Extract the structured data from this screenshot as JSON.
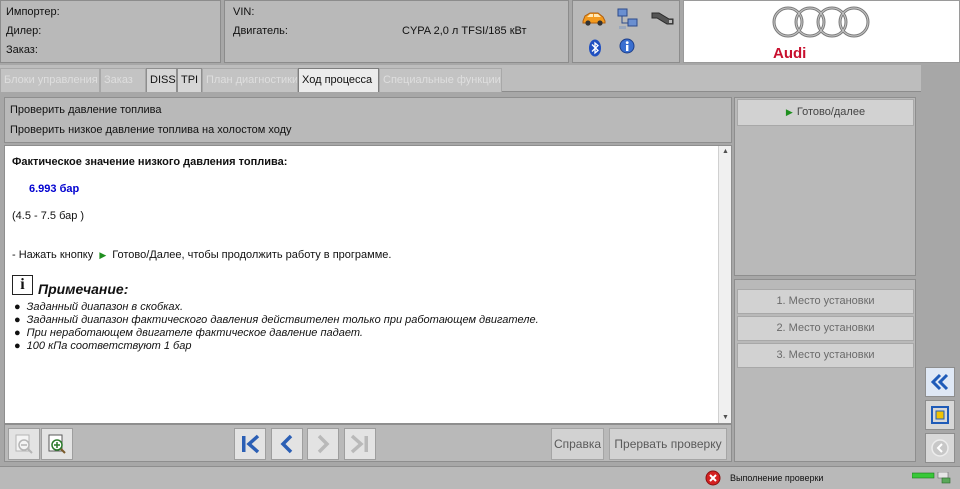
{
  "header": {
    "importer_label": "Импортер:",
    "dealer_label": "Дилер:",
    "order_label": "Заказ:",
    "vin_label": "VIN:",
    "engine_label": "Двигатель:",
    "engine_value": "CYPA 2,0 л TFSI/185 кВт",
    "brand": "Audi"
  },
  "tabs": [
    {
      "label": "Блоки управления"
    },
    {
      "label": "Заказ"
    },
    {
      "label": "DISS"
    },
    {
      "label": "TPI"
    },
    {
      "label": "План диагностики"
    },
    {
      "label": "Ход процесса"
    },
    {
      "label": "Специальные функции"
    }
  ],
  "panel": {
    "title1": "Проверить давление топлива",
    "title2": "Проверить низкое давление топлива на холостом ходу"
  },
  "content": {
    "heading": "Фактическое значение низкого давления топлива:",
    "value": "6.993 бар",
    "range": "(4.5 - 7.5 бар )",
    "instr_pre": "- Нажать кнопку",
    "instr_post": "Готово/Далее, чтобы продолжить работу в программе.",
    "note_title": "Примечание:",
    "notes": [
      "Заданный диапазон в скобках.",
      "Заданный диапазон фактического давления действителен только при работающем двигателе.",
      "При неработающем двигателе фактическое давление падает.",
      "100 кПа соответствуют 1 бар"
    ]
  },
  "toolbar": {
    "help_label": "Справка",
    "abort_label": "Прервать проверку"
  },
  "side": {
    "next_label": "Готово/далее",
    "places": [
      "1. Место установки",
      "2. Место установки",
      "3. Место установки"
    ]
  },
  "status": {
    "text": "Выполнение проверки"
  },
  "colors": {
    "accent_blue": "#2b5fb5",
    "value_blue": "#0000d0",
    "arrow_green": "#1f8f1f",
    "audi_red": "#c8102e",
    "error_red": "#d42020"
  }
}
